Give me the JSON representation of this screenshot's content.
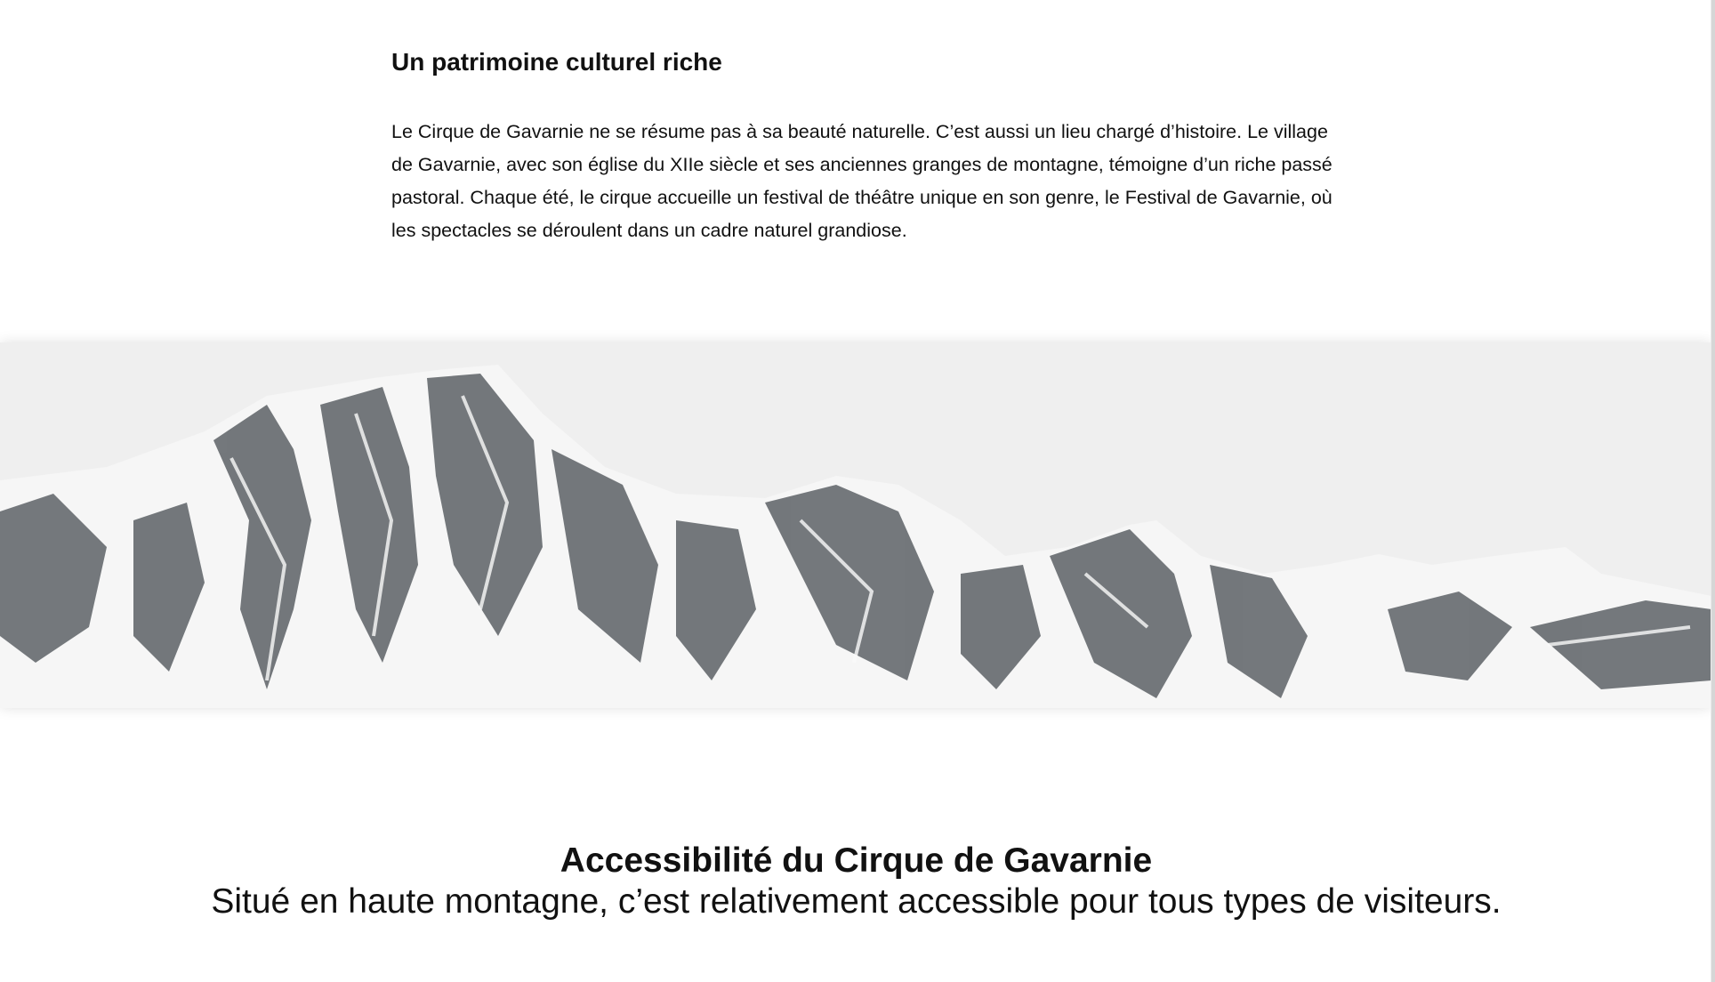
{
  "culture": {
    "title": "Un patrimoine culturel riche",
    "paragraph": "Le Cirque de Gavarnie ne se résume pas à sa beauté naturelle. C’est aussi un lieu chargé d’histoire. Le village de Gavarnie, avec son église du XIIe siècle et ses anciennes granges de montagne, témoigne d’un riche passé pastoral. Chaque été, le cirque accueille un festival de théâtre unique en son genre, le Festival de Gavarnie, où les spectacles se déroulent dans un cadre naturel grandiose."
  },
  "accessibility": {
    "title": "Accessibilité du Cirque de Gavarnie",
    "subtitle": "Situé en haute montagne, c’est relativement accessible pour tous types de visiteurs."
  }
}
